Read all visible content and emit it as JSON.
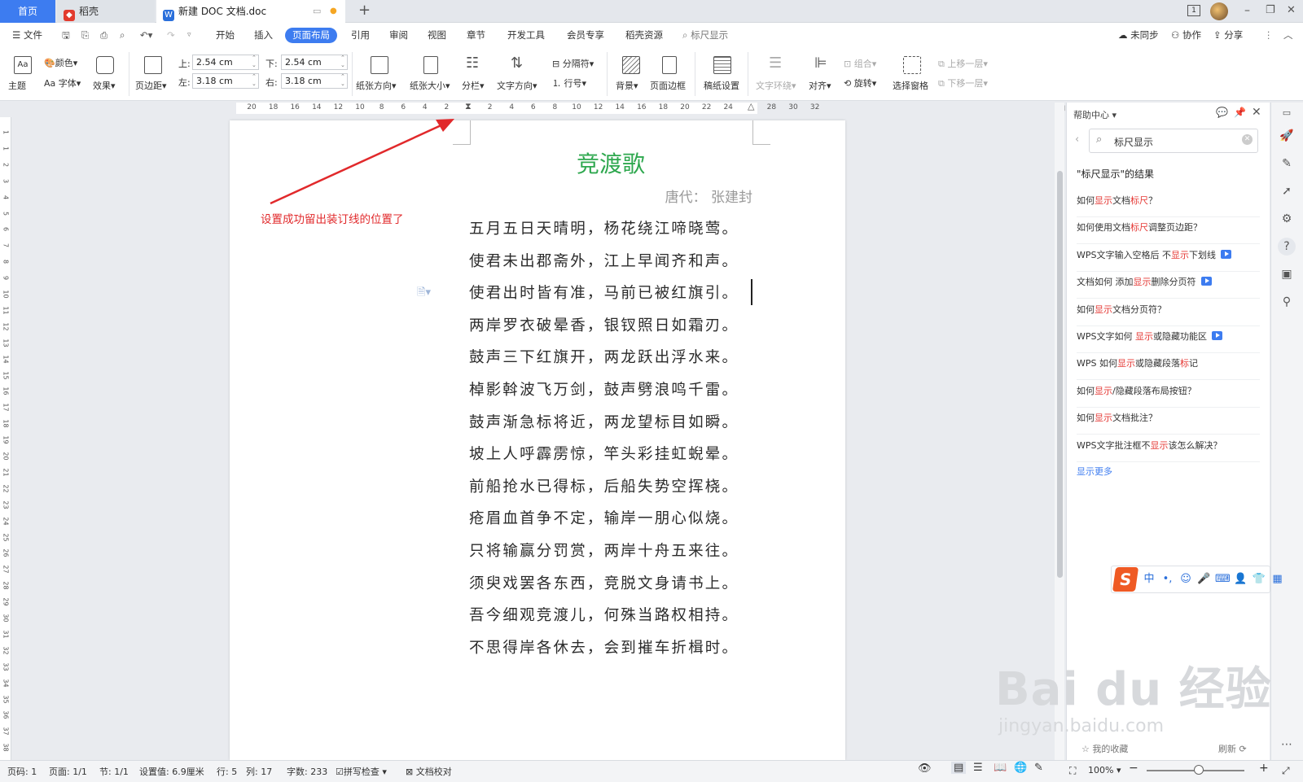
{
  "tabs": {
    "home": "首页",
    "daoke": "稻壳",
    "doc": "新建 DOC 文档.doc",
    "add": "+"
  },
  "window": {
    "badge": "1",
    "minimize": "–",
    "restore": "❐",
    "close": "✕"
  },
  "menu": {
    "file": "文件",
    "items": [
      "开始",
      "插入",
      "页面布局",
      "引用",
      "审阅",
      "视图",
      "章节",
      "开发工具",
      "会员专享",
      "稻壳资源"
    ],
    "search": "标尺显示",
    "sync": "未同步",
    "collab": "协作",
    "share": "分享"
  },
  "ribbon": {
    "theme": "主题",
    "color": "颜色",
    "font": "Aa 字体",
    "effect": "效果",
    "margin": "页边距",
    "top_label": "上:",
    "top_value": "2.54 cm",
    "bottom_label": "下:",
    "bottom_value": "2.54 cm",
    "left_label": "左:",
    "left_value": "3.18 cm",
    "right_label": "右:",
    "right_value": "3.18 cm",
    "orientation": "纸张方向",
    "size": "纸张大小",
    "columns": "分栏",
    "text_dir": "文字方向",
    "separator": "分隔符",
    "line_num": "行号",
    "background": "背景",
    "border": "页面边框",
    "paper": "稿纸设置",
    "wrap": "文字环绕",
    "align": "对齐",
    "group": "组合",
    "rotate": "旋转",
    "select_pane": "选择窗格",
    "up": "上移一层",
    "down": "下移一层"
  },
  "ruler": {
    "h": [
      "20",
      "18",
      "16",
      "14",
      "12",
      "10",
      "8",
      "6",
      "4",
      "2",
      "2",
      "4",
      "6",
      "8",
      "10",
      "12",
      "14",
      "16",
      "18",
      "20",
      "22",
      "24",
      "",
      "28",
      "30",
      "32"
    ],
    "v": [
      "1",
      "1",
      "2",
      "3",
      "4",
      "5",
      "6",
      "7",
      "8",
      "9",
      "10",
      "11",
      "12",
      "13",
      "14",
      "15",
      "16",
      "17",
      "18",
      "19",
      "20",
      "21",
      "22",
      "23",
      "24",
      "25",
      "26",
      "27",
      "28",
      "29",
      "30",
      "31",
      "32",
      "33",
      "34",
      "35",
      "36",
      "37",
      "38"
    ]
  },
  "doc": {
    "title": "竞渡歌",
    "author": "唐代： 张建封",
    "lines": [
      "五月五日天晴明，杨花绕江啼晓莺。",
      "使君未出郡斋外，江上早闻齐和声。",
      "使君出时皆有准，马前已被红旗引。",
      "两岸罗衣破晕香，银钗照日如霜刃。",
      "鼓声三下红旗开，两龙跃出浮水来。",
      "棹影斡波飞万剑，鼓声劈浪鸣千雷。",
      "鼓声渐急标将近，两龙望标目如瞬。",
      "坡上人呼霹雳惊，竿头彩挂虹蜺晕。",
      "前船抢水已得标，后船失势空挥桡。",
      "疮眉血首争不定，输岸一朋心似烧。",
      "只将输赢分罚赏，两岸十舟五来往。",
      "须臾戏罢各东西，竞脱文身请书上。",
      "吾今细观竞渡儿，何殊当路权相持。",
      "不思得岸各休去，会到摧车折楫时。"
    ]
  },
  "annotation": "设置成功留出装订线的位置了",
  "help": {
    "title": "帮助中心",
    "query": "标尺显示",
    "heading": "\"标尺显示\"的结果",
    "results": [
      {
        "pre": "如何",
        "hl": "显示",
        "mid": "文档",
        "hl2": "标尺",
        "post": "？",
        "video": false
      },
      {
        "pre": "如何使用文档",
        "hl": "标尺",
        "mid": "调整页边距？",
        "hl2": "",
        "post": "",
        "video": false
      },
      {
        "pre": "WPS文字输入空格后 不",
        "hl": "显示",
        "mid": "下划线",
        "hl2": "",
        "post": "",
        "video": true
      },
      {
        "pre": "文档如何 添加",
        "hl": "显示",
        "mid": "删除分页符",
        "hl2": "",
        "post": "",
        "video": true
      },
      {
        "pre": "如何",
        "hl": "显示",
        "mid": "文档分页符？",
        "hl2": "",
        "post": "",
        "video": false
      },
      {
        "pre": "WPS文字如何 ",
        "hl": "显示",
        "mid": "或隐藏功能区",
        "hl2": "",
        "post": "",
        "video": true
      },
      {
        "pre": "WPS 如何",
        "hl": "显示",
        "mid": "或隐藏段落",
        "hl2": "标",
        "post": "记",
        "video": false
      },
      {
        "pre": "如何",
        "hl": "显示",
        "mid": "/隐藏段落布局按钮？",
        "hl2": "",
        "post": "",
        "video": false
      },
      {
        "pre": "如何",
        "hl": "显示",
        "mid": "文档批注？",
        "hl2": "",
        "post": "",
        "video": false
      },
      {
        "pre": "WPS文字批注框不",
        "hl": "显示",
        "mid": "该怎么解决？",
        "hl2": "",
        "post": "",
        "video": false
      }
    ],
    "more": "显示更多",
    "favorites": "我的收藏",
    "refresh": "刷新"
  },
  "ime": {
    "logo": "S",
    "items": [
      "中",
      "•,",
      "☺",
      "🎤",
      "⌨",
      "👤",
      "👕",
      "▦"
    ]
  },
  "status": {
    "page_num": "页码: 1",
    "pages": "页面: 1/1",
    "section": "节: 1/1",
    "setting": "设置值: 6.9厘米",
    "row": "行: 5",
    "col": "列: 17",
    "words": "字数: 233",
    "spell": "拼写检查",
    "proof": "文档校对",
    "zoom": "100%"
  },
  "watermark": {
    "big": "Bai du 经验",
    "small": "jingyan.baidu.com"
  },
  "colors": {
    "accent": "#3d7cf0",
    "title_green": "#2fa84f",
    "annotation_red": "#e1292b"
  }
}
